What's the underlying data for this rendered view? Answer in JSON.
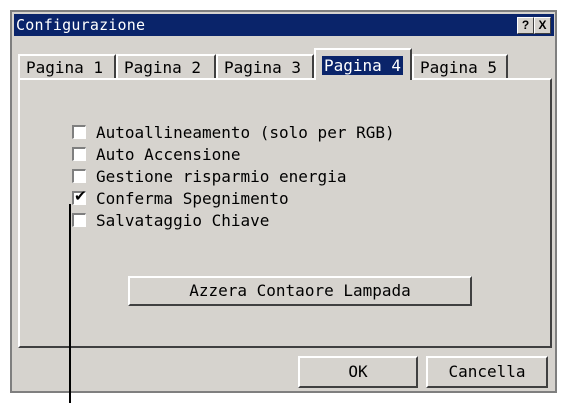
{
  "window": {
    "title": "Configurazione",
    "help_button": "?",
    "close_button": "X"
  },
  "tabs": [
    {
      "label": "Pagina 1",
      "active": false
    },
    {
      "label": "Pagina 2",
      "active": false
    },
    {
      "label": "Pagina 3",
      "active": false
    },
    {
      "label": "Pagina 4",
      "active": true
    },
    {
      "label": "Pagina 5",
      "active": false
    }
  ],
  "options": [
    {
      "label": "Autoallineamento (solo per RGB)",
      "checked": false
    },
    {
      "label": "Auto Accensione",
      "checked": false
    },
    {
      "label": "Gestione risparmio energia",
      "checked": false
    },
    {
      "label": "Conferma Spegnimento",
      "checked": true
    },
    {
      "label": "Salvataggio Chiave",
      "checked": false
    }
  ],
  "reset_button": "Azzera Contaore Lampada",
  "footer": {
    "ok_label": "OK",
    "cancel_label": "Cancella"
  },
  "colors": {
    "titlebar": "#0a246a",
    "face": "#d6d3ce",
    "highlight": "#ffffff",
    "shadow": "#404040"
  }
}
